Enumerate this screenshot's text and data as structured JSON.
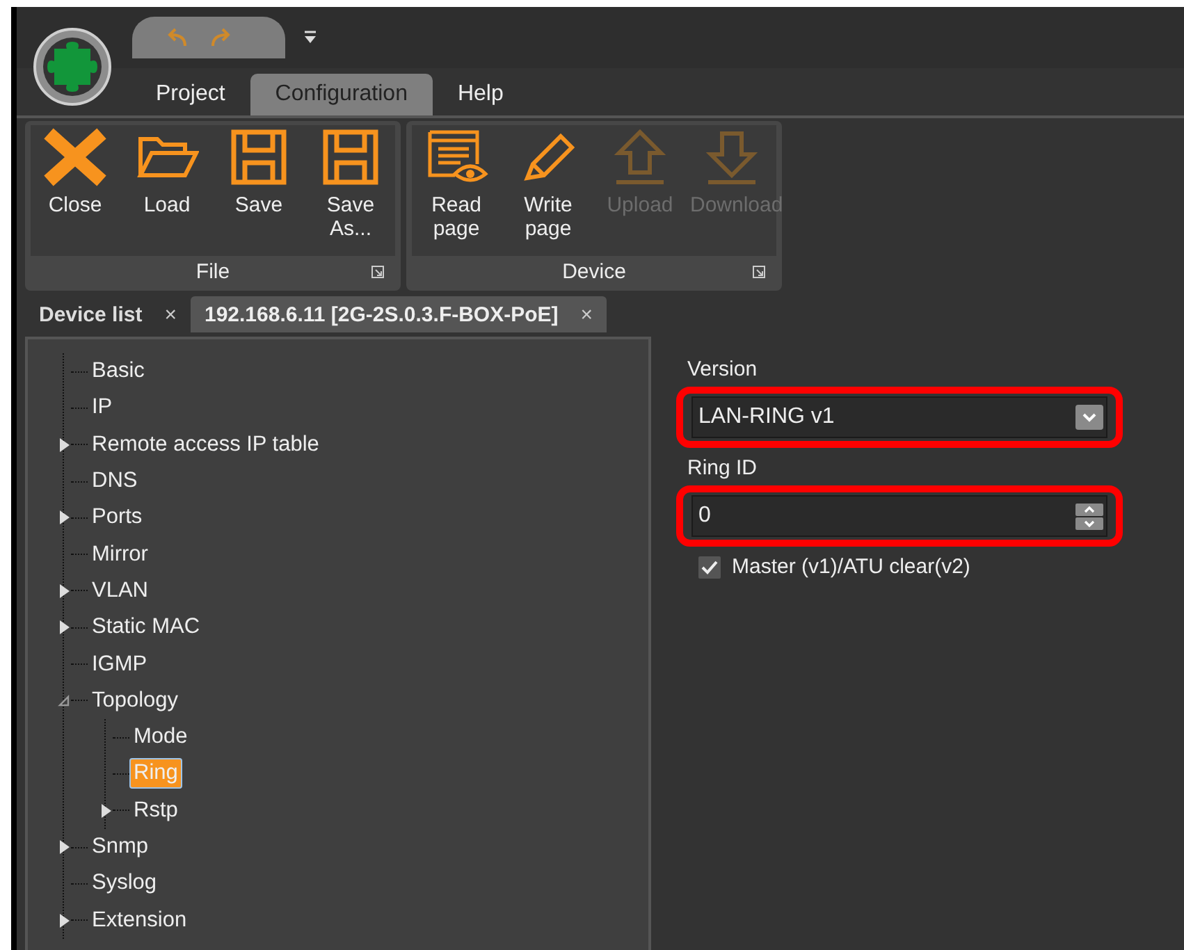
{
  "menu_tabs": [
    {
      "label": "Project",
      "selected": false
    },
    {
      "label": "Configuration",
      "selected": true
    },
    {
      "label": "Help",
      "selected": false
    }
  ],
  "ribbon_groups": [
    {
      "label": "File",
      "buttons": [
        {
          "label": "Close",
          "disabled": false
        },
        {
          "label": "Load",
          "disabled": false
        },
        {
          "label": "Save",
          "disabled": false
        },
        {
          "label": "Save As...",
          "disabled": false
        }
      ]
    },
    {
      "label": "Device",
      "buttons": [
        {
          "label": "Read page",
          "disabled": false
        },
        {
          "label": "Write page",
          "disabled": false
        },
        {
          "label": "Upload",
          "disabled": true
        },
        {
          "label": "Download",
          "disabled": true
        }
      ]
    }
  ],
  "doc_tabs": [
    {
      "label": "Device list",
      "selected": false,
      "close": "×"
    },
    {
      "label": "192.168.6.11 [2G-2S.0.3.F-BOX-PoE]",
      "selected": true,
      "close": "×"
    }
  ],
  "tree": [
    {
      "kind": "leaf",
      "label": "Basic",
      "selected": false
    },
    {
      "kind": "leaf",
      "label": "IP",
      "selected": false
    },
    {
      "kind": "folder",
      "label": "Remote access IP table",
      "selected": false,
      "expanded": false
    },
    {
      "kind": "leaf",
      "label": "DNS",
      "selected": false
    },
    {
      "kind": "folder",
      "label": "Ports",
      "selected": false,
      "expanded": false
    },
    {
      "kind": "leaf",
      "label": "Mirror",
      "selected": false
    },
    {
      "kind": "folder",
      "label": "VLAN",
      "selected": false,
      "expanded": false
    },
    {
      "kind": "folder",
      "label": "Static MAC",
      "selected": false,
      "expanded": false
    },
    {
      "kind": "leaf",
      "label": "IGMP",
      "selected": false
    },
    {
      "kind": "folder",
      "label": "Topology",
      "selected": false,
      "expanded": true,
      "children": [
        {
          "kind": "leaf",
          "label": "Mode",
          "selected": false
        },
        {
          "kind": "leaf",
          "label": "Ring",
          "selected": true
        },
        {
          "kind": "folder",
          "label": "Rstp",
          "selected": false,
          "expanded": false
        }
      ]
    },
    {
      "kind": "folder",
      "label": "Snmp",
      "selected": false,
      "expanded": false
    },
    {
      "kind": "leaf",
      "label": "Syslog",
      "selected": false
    },
    {
      "kind": "folder",
      "label": "Extension",
      "selected": false,
      "expanded": false
    }
  ],
  "form": [
    {
      "kind": "select",
      "label": "Version",
      "value": "LAN-RING v1",
      "highlighted": true
    },
    {
      "kind": "spinner",
      "label": "Ring ID",
      "value": "0",
      "highlighted": true
    },
    {
      "kind": "checkbox",
      "label": "Master (v1)/ATU clear(v2)",
      "checked": true,
      "highlighted": false
    }
  ]
}
